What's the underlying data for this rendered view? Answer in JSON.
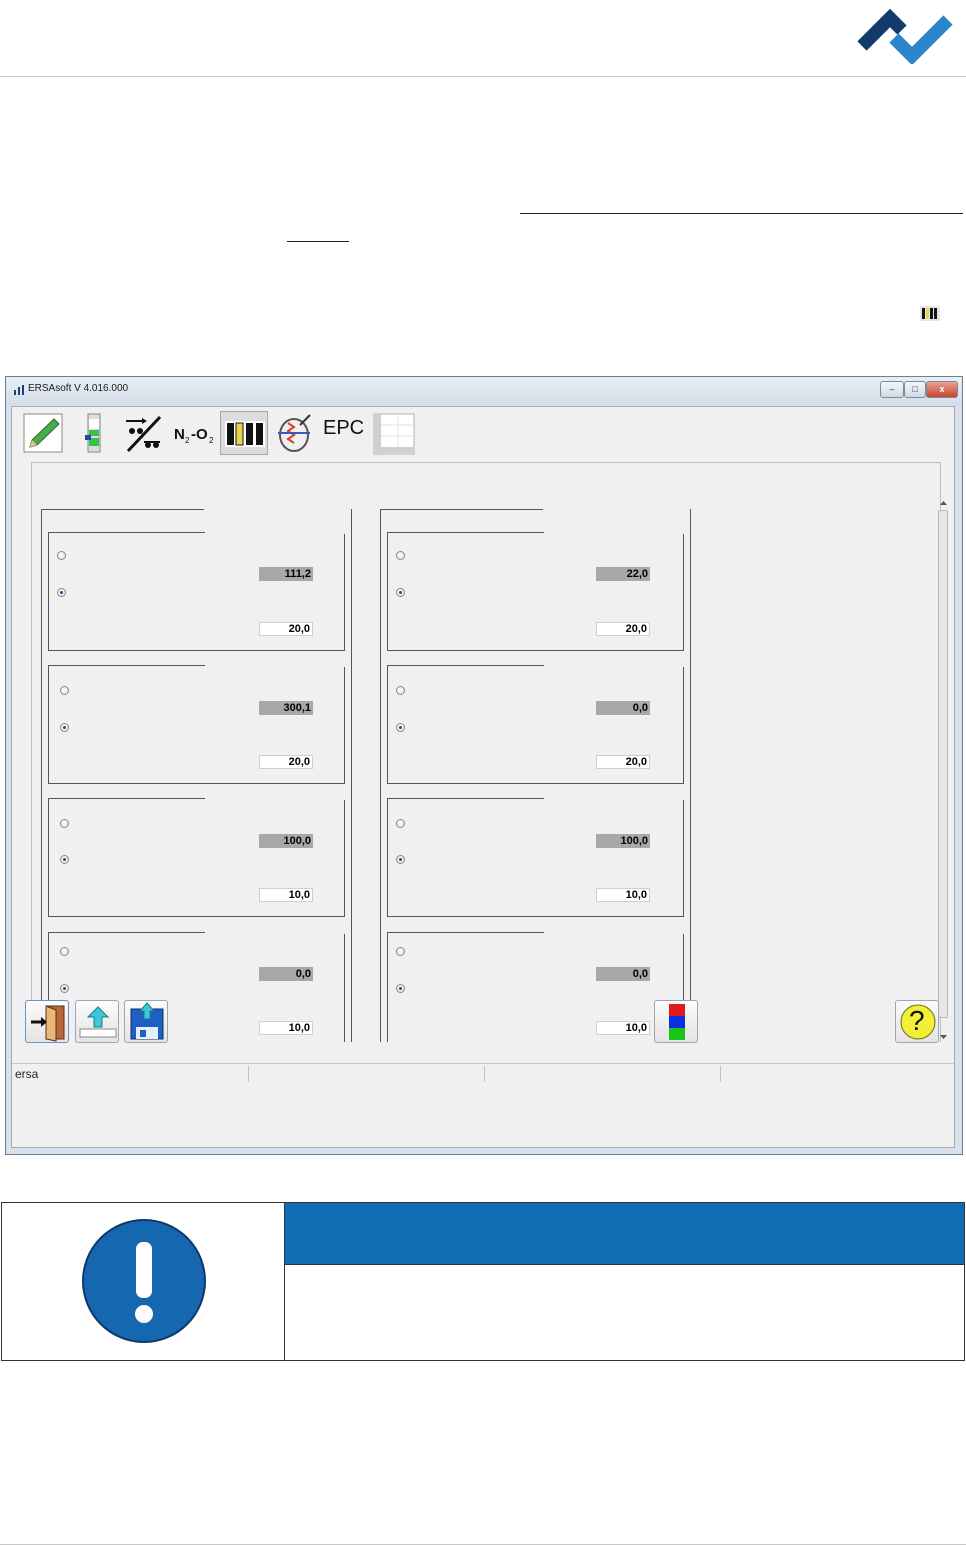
{
  "app": {
    "title": "ERSAsoft V 4.016.000",
    "toolbar": {
      "epc_label": "EPC",
      "icons": [
        "pencil-icon",
        "profile-bar-icon",
        "conveyor-icon",
        "n2-o2-icon",
        "zones-icon",
        "heater-icon",
        "epc-icon",
        "table-icon"
      ]
    },
    "left_group": {
      "boxes": [
        {
          "actual": "111,2",
          "set": "20,0",
          "selected": 2
        },
        {
          "actual": "300,1",
          "set": "20,0",
          "selected": 2
        },
        {
          "actual": "100,0",
          "set": "10,0",
          "selected": 2
        },
        {
          "actual": "0,0",
          "set": "10,0",
          "selected": 2
        }
      ]
    },
    "right_group": {
      "boxes": [
        {
          "actual": "22,0",
          "set": "20,0",
          "selected": 2
        },
        {
          "actual": "0,0",
          "set": "20,0",
          "selected": 2
        },
        {
          "actual": "100,0",
          "set": "10,0",
          "selected": 2
        },
        {
          "actual": "0,0",
          "set": "10,0",
          "selected": 2
        }
      ]
    },
    "help_label": "?",
    "status": {
      "user": "ersa"
    }
  },
  "colors": {
    "brand_dark": "#123a6b",
    "brand_light": "#2a86c9",
    "notice_header": "#0f6db3"
  }
}
